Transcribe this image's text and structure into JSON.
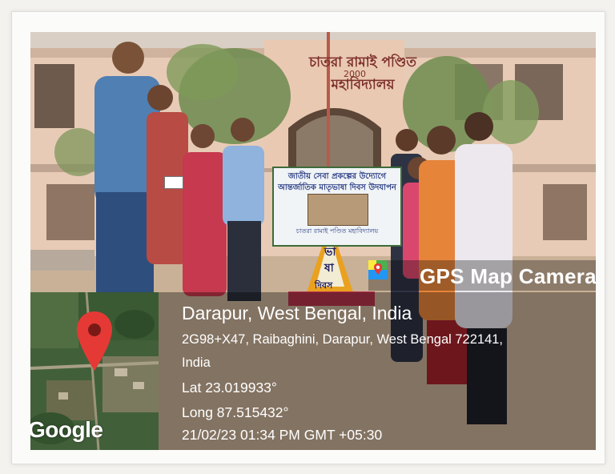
{
  "photo": {
    "building_sign": "চাতরা রামাই পণ্ডিত মহাবিদ্যালয়",
    "building_year": "2000",
    "banner": {
      "line1": "জাতীয় সেবা প্রকল্পের উদ্যোগে",
      "line2": "আন্তর্জাতিক মাতৃভাষা দিবস উদযাপন",
      "footer": "চাতরা রামাই পণ্ডিত মহাবিদ্যালয়"
    },
    "altar_letters": [
      "ভা",
      "ষা",
      "দিবস"
    ]
  },
  "app_badge": {
    "label": "GPS Map Camera",
    "icon": "map-pin-icon"
  },
  "map": {
    "logo_text": "Google",
    "marker_icon": "location-marker-icon",
    "marker_color": "#e53935"
  },
  "location": {
    "title": "Darapur, West Bengal, India",
    "address_line1": "2G98+X47, Raibaghini, Darapur, West Bengal 722141,",
    "address_line2": "India",
    "latitude": "Lat 23.019933°",
    "longitude": "Long 87.515432°",
    "datetime": "21/02/23 01:34 PM GMT +05:30"
  }
}
